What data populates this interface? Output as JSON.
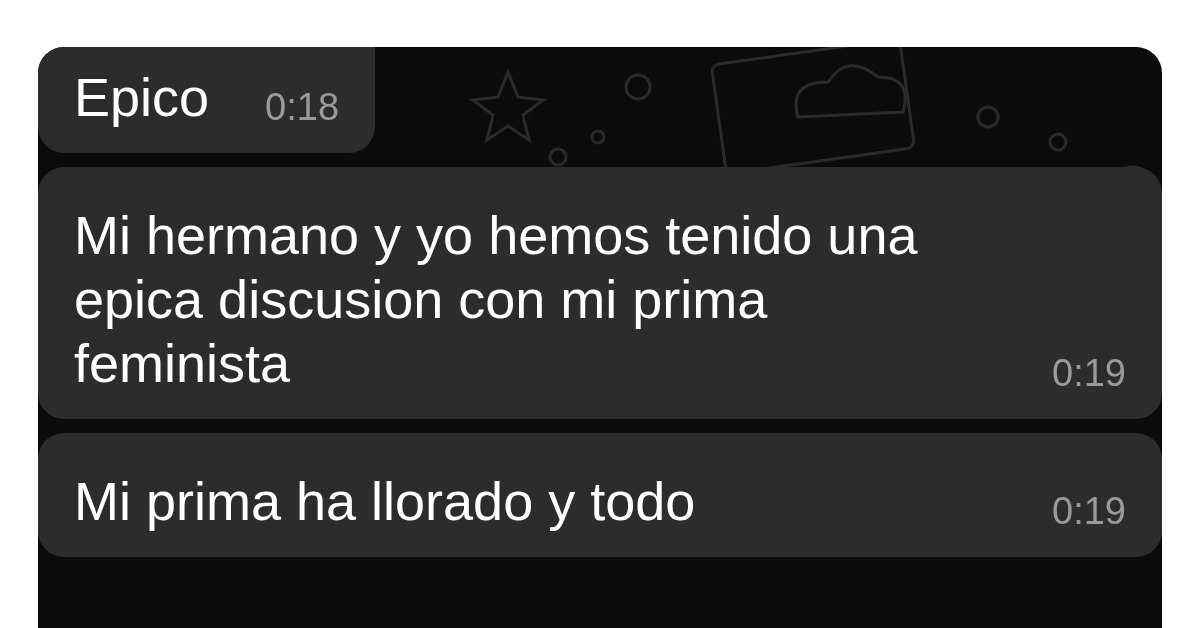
{
  "messages": [
    {
      "text": "Epico",
      "time": "0:18"
    },
    {
      "text": "Mi hermano y yo hemos tenido una epica discusion con mi prima feminista",
      "time": "0:19"
    },
    {
      "text": "Mi prima ha llorado y todo",
      "time": "0:19"
    }
  ]
}
